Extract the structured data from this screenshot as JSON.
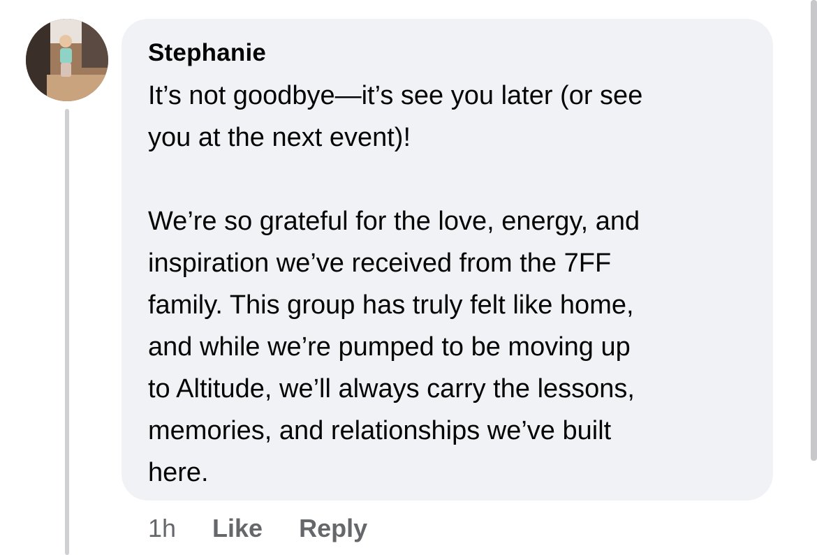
{
  "comment": {
    "author": "Stephanie",
    "paragraphs": [
      "It’s not goodbye—it’s see you later (or see\nyou at the next event)!",
      "We’re so grateful for the love, energy, and\ninspiration we’ve received from the 7FF\nfamily. This group has truly felt like home,\nand while we’re pumped to be moving up\nto Altitude, we’ll always carry the lessons,\nmemories, and relationships we’ve built\nhere."
    ],
    "timestamp": "1h",
    "like_label": "Like",
    "reply_label": "Reply"
  },
  "avatar": {
    "icon": "profile-photo"
  },
  "colors": {
    "bubble_bg": "#f0f2f5",
    "text": "#050505",
    "secondary_text": "#65676b",
    "thread_line": "#ced0d4"
  }
}
